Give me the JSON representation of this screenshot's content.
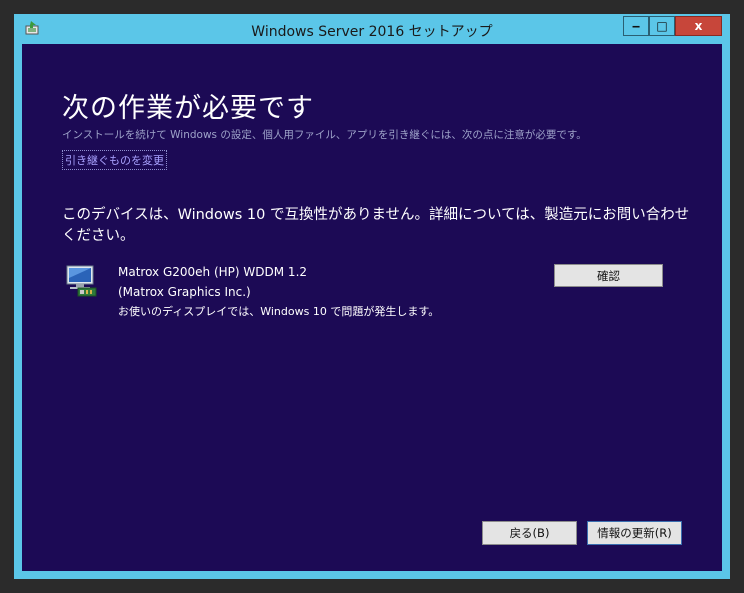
{
  "window": {
    "title": "Windows Server 2016 セットアップ",
    "controls": {
      "minimize": "‒",
      "maximize": "□",
      "close": "x"
    }
  },
  "content": {
    "heading": "次の作業が必要です",
    "subtext": "インストールを続けて Windows の設定、個人用ファイル、アプリを引き継ぐには、次の点に注意が必要です。",
    "change_link": "引き継ぐものを変更",
    "message": "このデバイスは、Windows 10 で互換性がありません。詳細については、製造元にお問い合わせください。",
    "device": {
      "name": "Matrox G200eh (HP) WDDM 1.2",
      "maker": "(Matrox Graphics Inc.)",
      "issue": "お使いのディスプレイでは、Windows 10 で問題が発生します。",
      "icon": "display-adapter-icon"
    },
    "confirm_button": "確認"
  },
  "footer": {
    "back_button": "戻る(B)",
    "refresh_button": "情報の更新(R)"
  },
  "colors": {
    "frame": "#5bc6e8",
    "content_bg": "#1c0a55",
    "close_button": "#c7463a"
  }
}
